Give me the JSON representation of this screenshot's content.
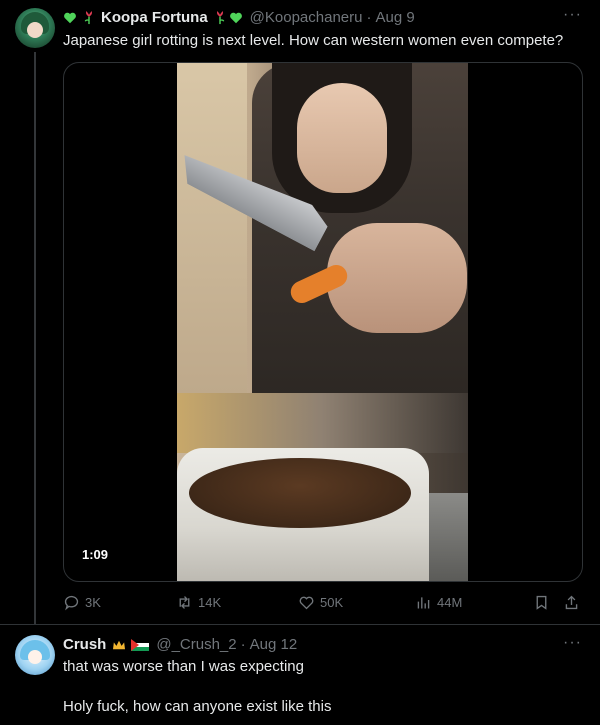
{
  "tweet1": {
    "author_name": "Koopa Fortuna",
    "handle": "@Koopachaneru",
    "date": "Aug 9",
    "separator": "·",
    "text": "Japanese girl rotting is next level. How can western women even compete?",
    "video_duration": "1:09",
    "actions": {
      "replies": "3K",
      "reposts": "14K",
      "likes": "50K",
      "views": "44M"
    },
    "more_label": "···",
    "accent_colors": {
      "heart": "#4fd45a",
      "flower": "#e03b53"
    }
  },
  "tweet2": {
    "author_name": "Crush",
    "handle": "@_Crush_2",
    "date": "Aug 12",
    "separator": "·",
    "more_label": "···",
    "text_line1": "that was worse than I was expecting",
    "text_line2": "Holy fuck, how can anyone exist like this"
  },
  "colors": {
    "background": "#000000",
    "text": "#e7e9ea",
    "muted": "#71767b",
    "border": "#2f3336"
  }
}
